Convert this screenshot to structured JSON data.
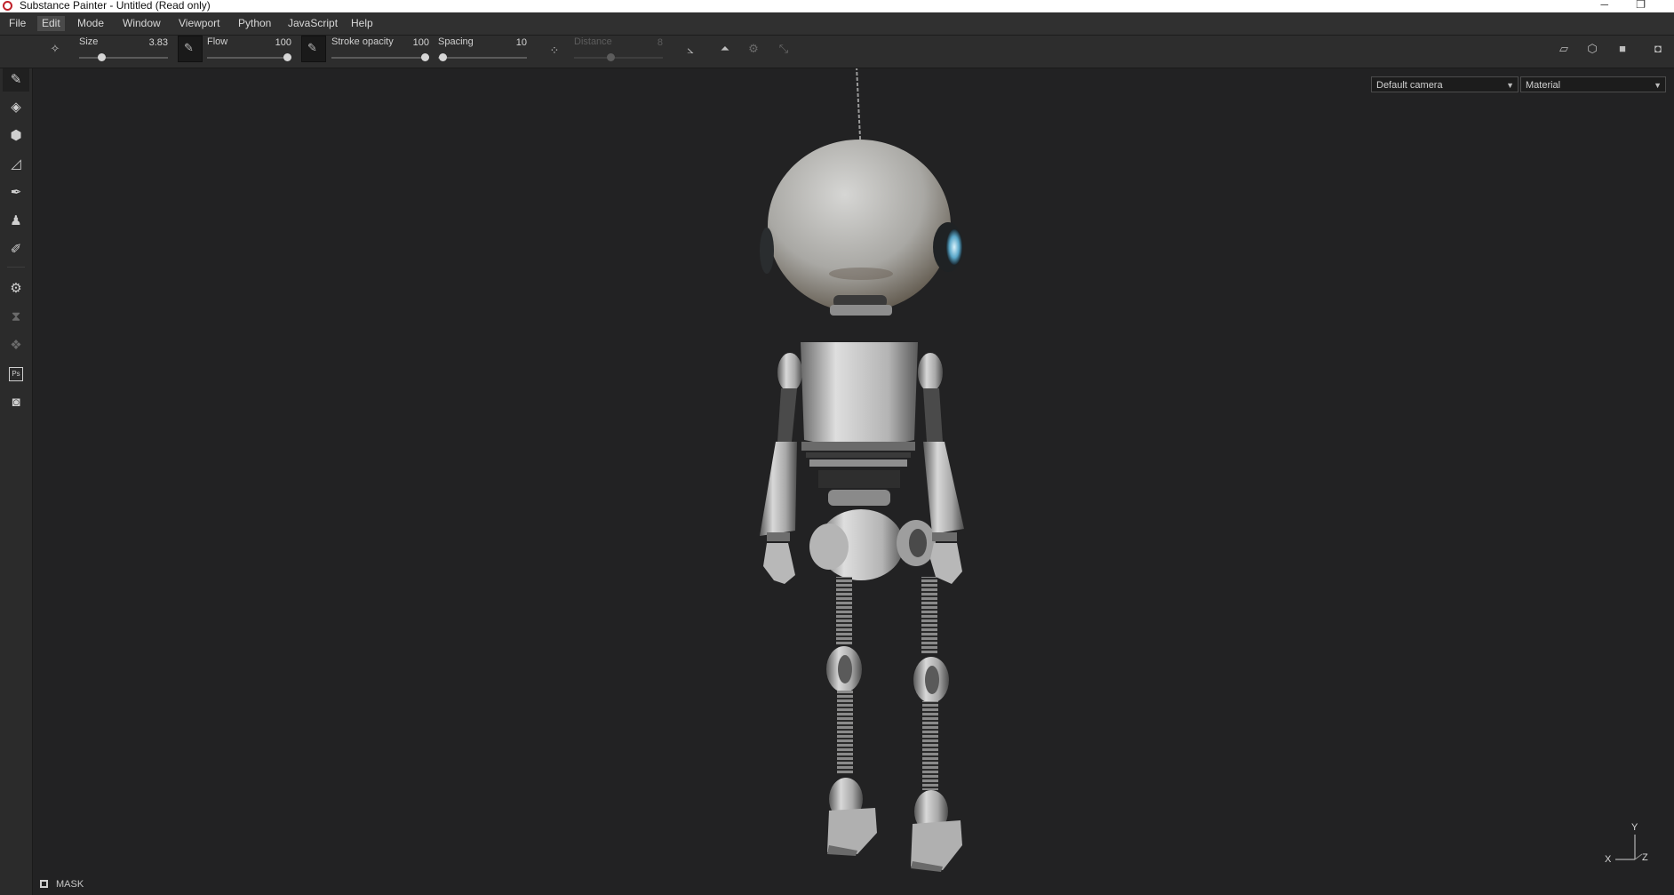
{
  "window": {
    "title": "Substance Painter - Untitled (Read only)",
    "minimize_glyph": "─",
    "restore_glyph": "❐"
  },
  "menu": {
    "items": [
      "File",
      "Edit",
      "Mode",
      "Window",
      "Viewport",
      "Python",
      "JavaScript",
      "Help"
    ],
    "active": "Edit"
  },
  "toolbar": {
    "size": {
      "label": "Size",
      "value": "3.83",
      "level": 0.22
    },
    "flow": {
      "label": "Flow",
      "value": "100",
      "level": 1.0
    },
    "stroke_opacity": {
      "label": "Stroke opacity",
      "value": "100",
      "level": 1.0
    },
    "spacing": {
      "label": "Spacing",
      "value": "10",
      "level": 0.0
    },
    "distance": {
      "label": "Distance",
      "value": "8",
      "level": 0.4,
      "disabled": true
    },
    "icons": [
      "brush-preset-icon",
      "size-pressure-icon",
      "flow-pressure-icon",
      "lazy-mouse-icon",
      "angle-icon",
      "symmetry-icon",
      "symmetry-settings-icon",
      "transform-icon",
      "2d-view-icon",
      "3d-view-icon",
      "camera-icon",
      "screenshot-icon"
    ]
  },
  "left_tools": [
    {
      "name": "paint-tool",
      "glyph": "✎",
      "active": true
    },
    {
      "name": "eraser-tool",
      "glyph": "◈"
    },
    {
      "name": "projection-tool",
      "glyph": "⬢"
    },
    {
      "name": "polygon-fill-tool",
      "glyph": "◿"
    },
    {
      "name": "smudge-tool",
      "glyph": "✒"
    },
    {
      "name": "clone-tool",
      "glyph": "♟"
    },
    {
      "name": "color-picker-tool",
      "glyph": "✐"
    },
    {
      "name": "bake-settings",
      "glyph": "⚙"
    },
    {
      "name": "export-tool",
      "glyph": "⧗",
      "dim": true
    },
    {
      "name": "material-tool",
      "glyph": "❖",
      "dim": true
    },
    {
      "name": "photoshop-tool",
      "glyph": "Ps"
    },
    {
      "name": "render-tool",
      "glyph": "◙"
    }
  ],
  "viewport": {
    "camera_select": "Default camera",
    "view_mode_select": "Material",
    "mask_label": "MASK",
    "axis": {
      "y": "Y",
      "x": "X",
      "z": "Z"
    }
  }
}
